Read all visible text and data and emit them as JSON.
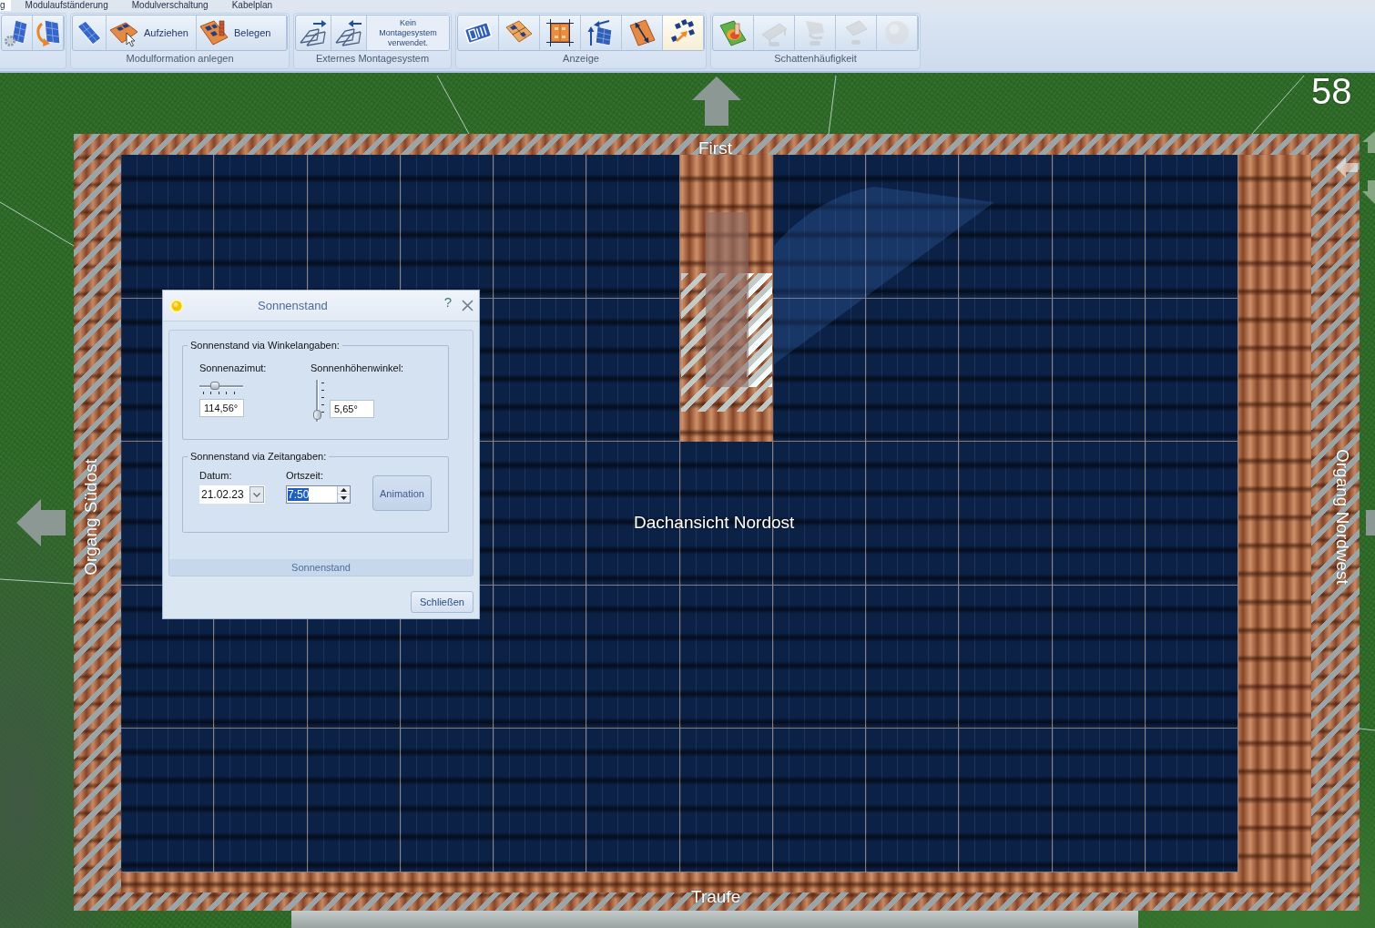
{
  "tabs": [
    {
      "label": "g",
      "selected": true
    },
    {
      "label": "Modulaufständerung",
      "selected": false
    },
    {
      "label": "Modulverschaltung",
      "selected": false
    },
    {
      "label": "Kabelplan",
      "selected": false
    }
  ],
  "ribbon": {
    "groups": [
      {
        "buttons": [
          {
            "disabled": false
          },
          {
            "disabled": false
          }
        ]
      },
      {
        "label": "Modulformation anlegen",
        "buttons": [
          {
            "disabled": false
          },
          {
            "text": "Aufziehen",
            "disabled": false
          },
          {
            "text": "Belegen",
            "disabled": false
          }
        ]
      },
      {
        "label": "Externes Montagesystem",
        "buttons": [
          {
            "disabled": false
          },
          {
            "disabled": false
          }
        ],
        "status": "Kein Montagesystem verwendet."
      },
      {
        "label": "Anzeige",
        "buttons": [
          {
            "selected": false,
            "disabled": false
          },
          {
            "selected": false,
            "disabled": false
          },
          {
            "selected": false,
            "disabled": false
          },
          {
            "selected": false,
            "disabled": false
          },
          {
            "selected": false,
            "disabled": false
          },
          {
            "selected": true,
            "disabled": false
          }
        ]
      },
      {
        "label": "Schattenhäufigkeit",
        "buttons": [
          {
            "disabled": false
          },
          {
            "disabled": true
          },
          {
            "disabled": true
          },
          {
            "disabled": true
          },
          {
            "disabled": true
          }
        ]
      }
    ]
  },
  "view": {
    "module_count": "58",
    "top_label": "First",
    "left_label": "Organg Südost",
    "title": "Dachansicht Nordost",
    "right_label": "Organg Nordwest",
    "bottom_label": "Traufe"
  },
  "dialog": {
    "title": "Sonnenstand",
    "help": "?",
    "angle_group": {
      "legend": "Sonnenstand via Winkelangaben:",
      "azimuth": {
        "label": "Sonnenazimut:",
        "level": 0.32,
        "value": "114,56°"
      },
      "elevation": {
        "label": "Sonnenhöhenwinkel:",
        "level": 0.06,
        "value": "5,65°"
      }
    },
    "time_group": {
      "legend": "Sonnenstand via Zeitangaben:",
      "date": {
        "label": "Datum:",
        "value": "21.02.23"
      },
      "time": {
        "label": "Ortszeit:",
        "value": "7:50",
        "text_selected": true
      },
      "button": "Animation"
    },
    "footer": "Sonnenstand",
    "close_button": "Schließen"
  }
}
